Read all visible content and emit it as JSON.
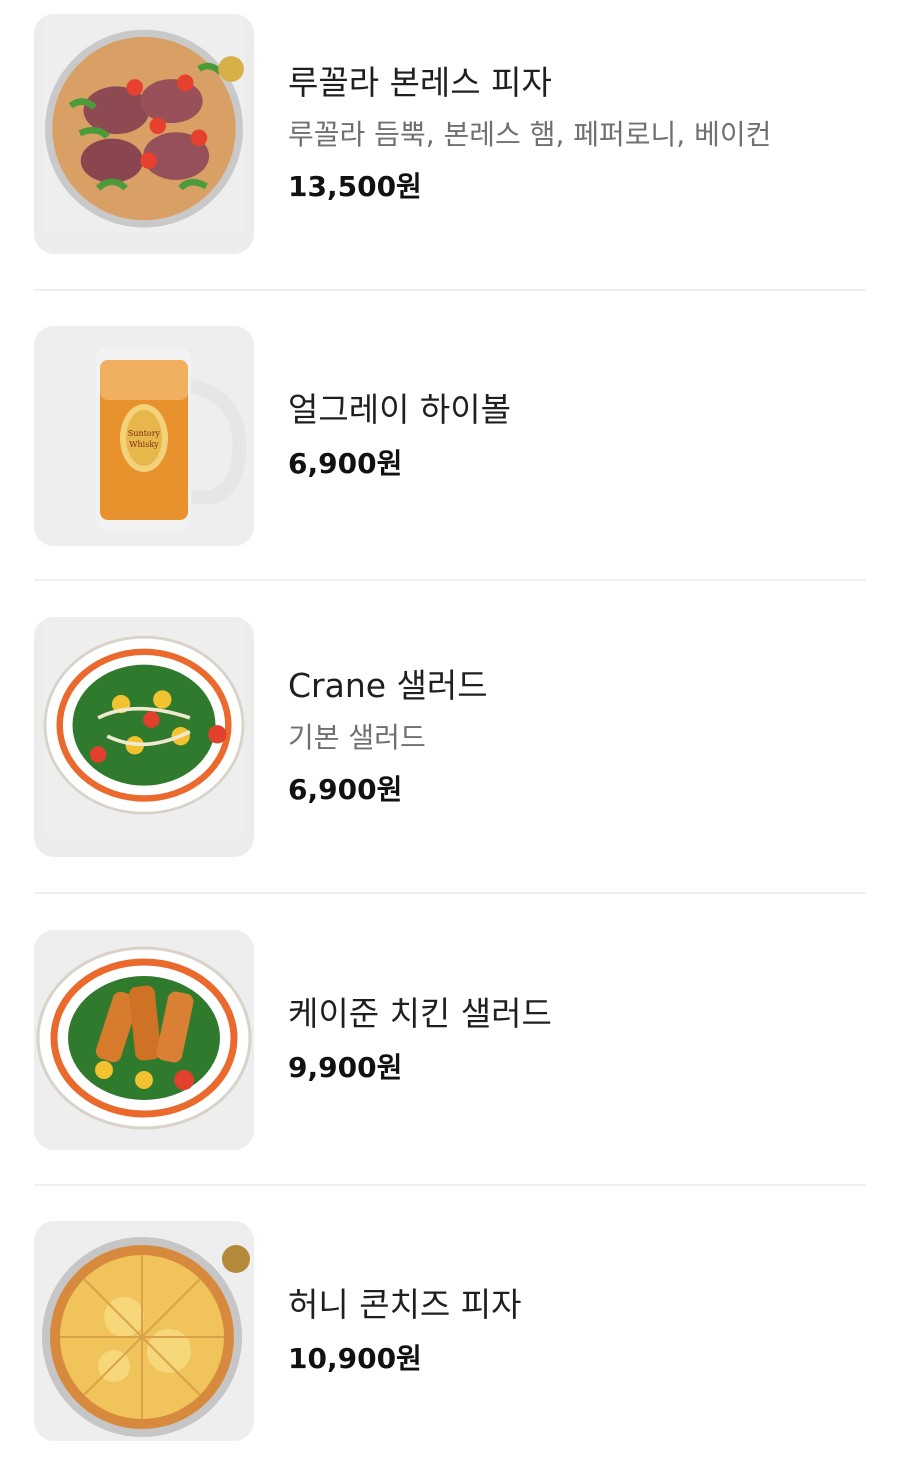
{
  "menu": {
    "items": [
      {
        "name": "루꼴라 본레스 피자",
        "description": "루꼴라 듬뿍, 본레스 햄, 페퍼로니, 베이컨",
        "price": "13,500원"
      },
      {
        "name": "얼그레이 하이볼",
        "description": "",
        "price": "6,900원"
      },
      {
        "name": "Crane 샐러드",
        "description": "기본 샐러드",
        "price": "6,900원"
      },
      {
        "name": "케이준 치킨 샐러드",
        "description": "",
        "price": "9,900원"
      },
      {
        "name": "허니 콘치즈 피자",
        "description": "",
        "price": "10,900원"
      }
    ]
  },
  "colors": {
    "text": "#1f1f1f",
    "subtext": "#707070",
    "divider": "#efefef",
    "thumb_bg": "#ececec"
  }
}
